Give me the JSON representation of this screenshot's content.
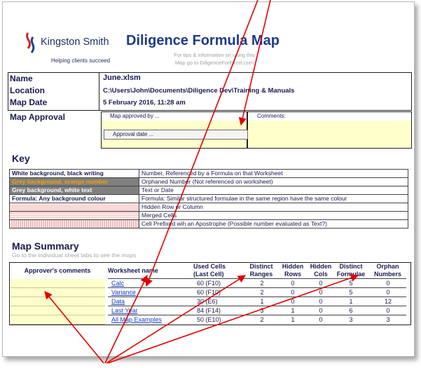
{
  "header": {
    "brand": "Kingston Smith",
    "tagline": "Helping clients succeed",
    "title": "Diligence Formula Map",
    "tips_line1": "For tips & information on using this",
    "tips_line2": "Map go to DiligenceForExcel.com"
  },
  "info": {
    "name_label": "Name",
    "name_value": "June.xlsm",
    "location_label": "Location",
    "location_value": "C:\\Users\\John\\Documents\\Diligence Dev\\Training & Manuals",
    "date_label": "Map Date",
    "date_value": "5 February 2016, 11:28 am",
    "approval_label": "Map Approval",
    "approved_by": "Map approved by ...",
    "comments": "Comments:",
    "approval_date_button": "Approval date ..."
  },
  "key": {
    "title": "Key",
    "rows": [
      {
        "label": "White background, black writing",
        "desc": "Number, Referenced by a Formula on that Worksheet"
      },
      {
        "label": "Grey background, orange number",
        "desc": "Orphaned Number (Not referenced on worksheet)"
      },
      {
        "label": "Grey background, white text",
        "desc": "Text or Date"
      },
      {
        "label": "Formula: Any background colour",
        "desc": "Formula: Similar structured formulae in the same region have the same colour"
      },
      {
        "label": "",
        "desc": "Hidden Row or Column"
      },
      {
        "label": "",
        "desc": "Merged Cells"
      },
      {
        "label": "",
        "desc": "Cell Prefixed wih an Apostrophe (Possible number evaluated as Text?)"
      }
    ]
  },
  "summary": {
    "title": "Map Summary",
    "subtitle": "Go to the individual sheet tabs to see the maps",
    "headers": {
      "approver": "Approver's comments",
      "worksheet": "Worksheet name",
      "used1": "Used Cells",
      "used2": "(Last Cell)",
      "ranges1": "Distinct",
      "ranges2": "Ranges",
      "hrows1": "Hidden",
      "hrows2": "Rows",
      "hcols1": "Hidden",
      "hcols2": "Cols",
      "formulae1": "Distinct",
      "formulae2": "Formulae",
      "orphan1": "Orphan",
      "orphan2": "Numbers"
    },
    "rows": [
      {
        "sheet": "Calc",
        "used": "60 (F10)",
        "ranges": "2",
        "hrows": "0",
        "hcols": "0",
        "formulae": "5",
        "orphans": "0"
      },
      {
        "sheet": "Variance",
        "used": "60 (F10)",
        "ranges": "2",
        "hrows": "0",
        "hcols": "0",
        "formulae": "5",
        "orphans": "0"
      },
      {
        "sheet": "Data",
        "used": "30 (E6)",
        "ranges": "1",
        "hrows": "0",
        "hcols": "0",
        "formulae": "1",
        "orphans": "12"
      },
      {
        "sheet": "Last Year",
        "used": "84 (F14)",
        "ranges": "3",
        "hrows": "1",
        "hcols": "0",
        "formulae": "6",
        "orphans": "0"
      },
      {
        "sheet": "All Map Examples",
        "used": "50 (E10)",
        "ranges": "2",
        "hrows": "1",
        "hcols": "0",
        "formulae": "3",
        "orphans": "3"
      }
    ]
  },
  "colors": {
    "arrow": "#e00000",
    "title": "#1f3a8a",
    "approver_fill": "#ffffcc",
    "link": "#1a3fc4"
  }
}
